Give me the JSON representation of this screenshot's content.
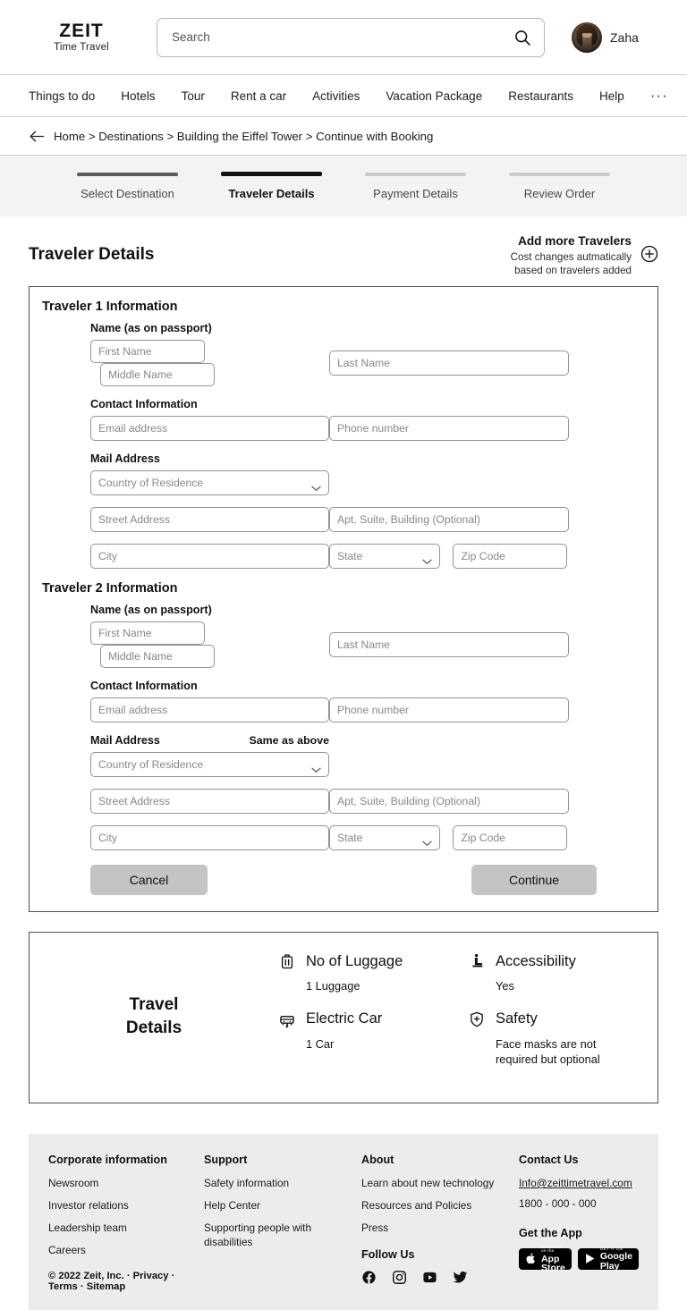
{
  "header": {
    "logo_main": "ZEIT",
    "logo_sub": "Time Travel",
    "search_placeholder": "Search",
    "search_value": "",
    "search_icon": "search-icon",
    "user_name": "Zaha"
  },
  "nav": {
    "items": [
      "Things to do",
      "Hotels",
      "Tour",
      "Rent a car",
      "Activities",
      "Vacation Package",
      "Restaurants",
      "Help"
    ],
    "more": "···"
  },
  "breadcrumb": {
    "back_icon": "back-arrow-icon",
    "text": "Home > Destinations > Building the Eiffel Tower > Continue with Booking"
  },
  "stepper": {
    "steps": [
      {
        "label": "Select Destination",
        "state": "done"
      },
      {
        "label": "Traveler Details",
        "state": "active"
      },
      {
        "label": "Payment Details",
        "state": "upcoming"
      },
      {
        "label": "Review Order",
        "state": "upcoming"
      }
    ]
  },
  "main": {
    "page_title": "Traveler Details",
    "add_travelers": {
      "title": "Add more Travelers",
      "sub_line1": "Cost changes autmatically",
      "sub_line2": "based on travelers added",
      "icon": "plus-circle-icon"
    },
    "labels": {
      "name": "Name (as on passport)",
      "contact": "Contact Information",
      "mail": "Mail Address",
      "same_as_above": "Same as above"
    },
    "placeholders": {
      "first_name": "First Name",
      "middle_name": "Middle Name",
      "last_name": "Last Name",
      "email": "Email address",
      "phone": "Phone number",
      "country": "Country of Residence",
      "street": "Street Address",
      "apt": "Apt, Suite, Building (Optional)",
      "city": "City",
      "state": "State",
      "zip": "Zip Code"
    },
    "travelers": [
      {
        "heading": "Traveler 1 Information",
        "show_same_as_above": false
      },
      {
        "heading": "Traveler 2 Information",
        "show_same_as_above": true
      }
    ],
    "buttons": {
      "cancel": "Cancel",
      "continue": "Continue"
    }
  },
  "travel_details": {
    "title_line1": "Travel",
    "title_line2": "Details",
    "items": [
      {
        "icon": "luggage-icon",
        "name": "No of Luggage",
        "value": "1 Luggage"
      },
      {
        "icon": "electric-car-icon",
        "name": "Electric Car",
        "value": "1 Car"
      },
      {
        "icon": "accessibility-icon",
        "name": "Accessibility",
        "value": "Yes"
      },
      {
        "icon": "shield-safety-icon",
        "name": "Safety",
        "value": "Face masks are not required but optional"
      }
    ]
  },
  "footer": {
    "corporate": {
      "heading": "Corporate information",
      "links": [
        "Newsroom",
        "Investor relations",
        "Leadership team",
        "Careers"
      ]
    },
    "support": {
      "heading": "Support",
      "links": [
        "Safety information",
        "Help Center",
        "Supporting people  with disabilities"
      ]
    },
    "about": {
      "heading": "About",
      "links": [
        "Learn about new technology",
        "Resources and Policies",
        "Press"
      ]
    },
    "follow": {
      "heading": "Follow Us",
      "socials": [
        "facebook-icon",
        "instagram-icon",
        "youtube-icon",
        "twitter-icon"
      ]
    },
    "contact": {
      "heading": "Contact Us",
      "email": "Info@zeittimetravel.com",
      "phone": "1800 - 000 - 000"
    },
    "get_app": {
      "heading": "Get the App",
      "apple": {
        "small": "Download on the",
        "big": "App Store"
      },
      "google": {
        "small": "GET IT ON",
        "big": "Google Play"
      }
    },
    "copyright": "© 2022 Zeit, Inc. · Privacy · Terms · Sitemap"
  },
  "colors": {
    "accent_dark": "#111111",
    "step_done": "#5a5a5a",
    "step_upcoming": "#cccccc",
    "button_bg": "#c4c4c4",
    "footer_bg": "#ececec",
    "border": "#4d4d4d"
  }
}
